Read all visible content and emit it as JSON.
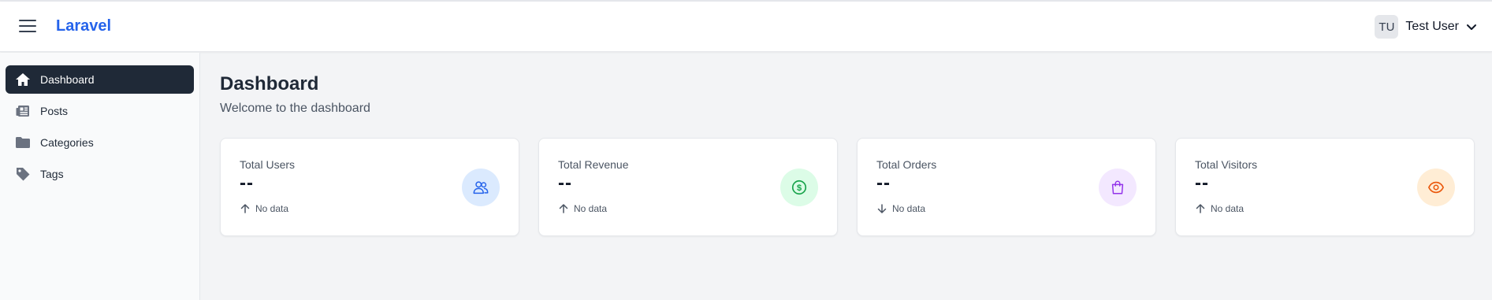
{
  "header": {
    "brand": "Laravel",
    "user": {
      "initials": "TU",
      "name": "Test User"
    }
  },
  "sidebar": {
    "items": [
      {
        "label": "Dashboard",
        "icon": "home-icon",
        "active": true
      },
      {
        "label": "Posts",
        "icon": "newspaper-icon",
        "active": false
      },
      {
        "label": "Categories",
        "icon": "folder-icon",
        "active": false
      },
      {
        "label": "Tags",
        "icon": "tag-icon",
        "active": false
      }
    ]
  },
  "main": {
    "title": "Dashboard",
    "subtitle": "Welcome to the dashboard",
    "cards": [
      {
        "title": "Total Users",
        "value": "--",
        "trend": "No data",
        "trend_dir": "up",
        "icon": "users-icon",
        "icon_color": "#2563eb",
        "icon_bg": "#dbeafe"
      },
      {
        "title": "Total Revenue",
        "value": "--",
        "trend": "No data",
        "trend_dir": "up",
        "icon": "dollar-circle-icon",
        "icon_color": "#16a34a",
        "icon_bg": "#dcfce7"
      },
      {
        "title": "Total Orders",
        "value": "--",
        "trend": "No data",
        "trend_dir": "down",
        "icon": "shopping-bag-icon",
        "icon_color": "#9333ea",
        "icon_bg": "#f3e8ff"
      },
      {
        "title": "Total Visitors",
        "value": "--",
        "trend": "No data",
        "trend_dir": "up",
        "icon": "eye-icon",
        "icon_color": "#ea580c",
        "icon_bg": "#ffedd5"
      }
    ]
  },
  "colors": {
    "brand": "#2563eb",
    "sidebar_active_bg": "#1f2937",
    "page_bg": "#f3f4f6"
  }
}
